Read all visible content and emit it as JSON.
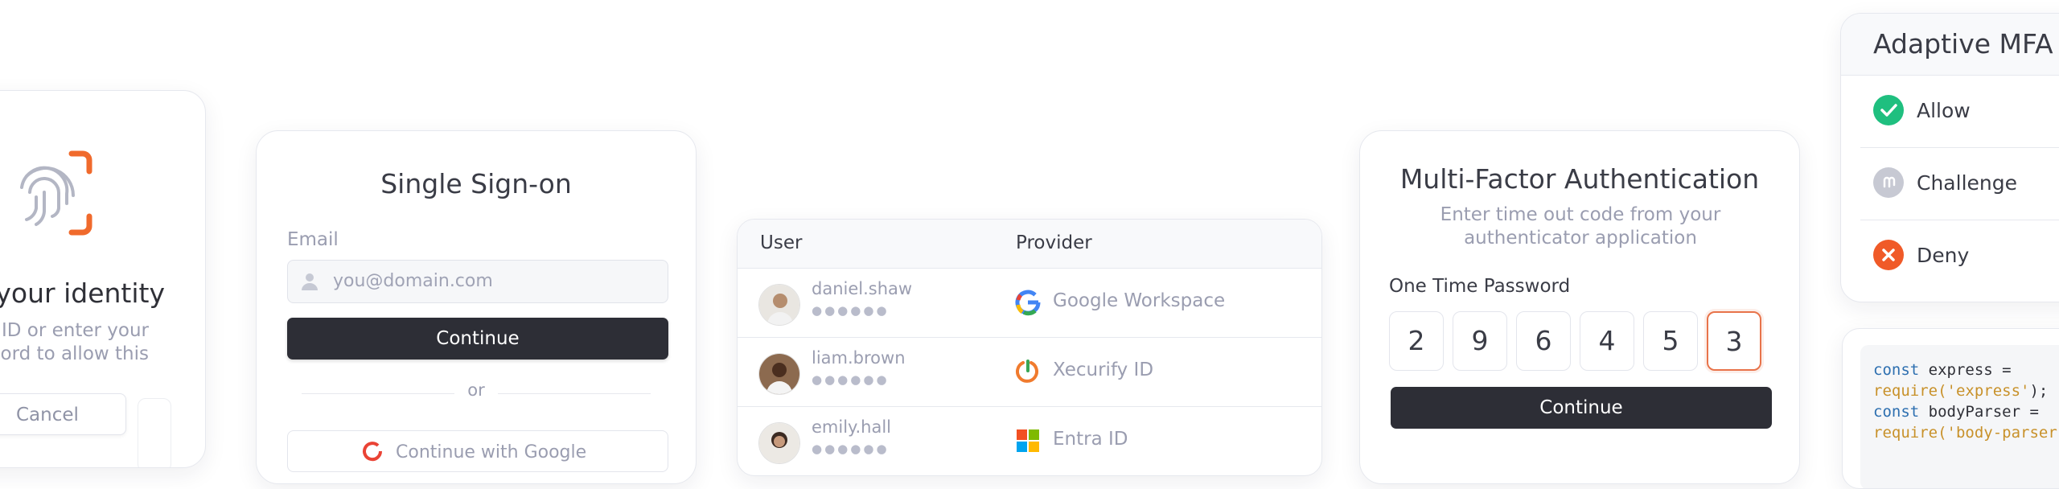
{
  "verify_card": {
    "title": "your identity",
    "subtitle_lines": [
      "ID or enter your",
      "word to allow this"
    ],
    "cancel_label": "Cancel"
  },
  "sso_card": {
    "title": "Single Sign-on",
    "email_label": "Email",
    "email_placeholder": "you@domain.com",
    "continue_label": "Continue",
    "divider_text": "or",
    "google_label": "Continue with Google"
  },
  "users_table": {
    "columns": [
      "User",
      "Provider"
    ],
    "rows": [
      {
        "user": "daniel.shaw",
        "masked": "●●●●●●",
        "provider": "Google Workspace",
        "provider_icon": "google-icon"
      },
      {
        "user": "liam.brown",
        "masked": "●●●●●●",
        "provider": "Xecurify ID",
        "provider_icon": "xecurify-icon"
      },
      {
        "user": "emily.hall",
        "masked": "●●●●●●",
        "provider": "Entra ID",
        "provider_icon": "microsoft-icon"
      }
    ]
  },
  "mfa_card": {
    "title": "Multi-Factor Authentication",
    "subtitle_lines": [
      "Enter time out code from your",
      "authenticator application"
    ],
    "otp_label": "One Time Password",
    "otp_digits": [
      "2",
      "9",
      "6",
      "4",
      "5",
      "3"
    ],
    "continue_label": "Continue"
  },
  "adaptive_card": {
    "title": "Adaptive MFA",
    "items": [
      {
        "label": "Allow",
        "color": "#1fbf7f",
        "icon": "check-icon"
      },
      {
        "label": "Challenge",
        "color": "#c7c9d3",
        "icon": "challenge-icon"
      },
      {
        "label": "Deny",
        "color": "#f05a28",
        "icon": "x-icon"
      }
    ]
  },
  "code_card": {
    "lines": [
      [
        {
          "t": "const",
          "c": "kw"
        },
        {
          "t": " express =",
          "c": "plain"
        }
      ],
      [
        {
          "t": "require(",
          "c": "str"
        },
        {
          "t": "'express'",
          "c": "str"
        },
        {
          "t": ");",
          "c": "plain"
        }
      ],
      [
        {
          "t": "const",
          "c": "kw"
        },
        {
          "t": " bodyParser =",
          "c": "plain"
        }
      ],
      [
        {
          "t": "require(",
          "c": "str"
        },
        {
          "t": "'body-parser'",
          "c": "str"
        }
      ]
    ]
  },
  "colors": {
    "accent": "#f06a2c",
    "button_dark": "#2d2e36",
    "muted_text": "#9a9db0"
  }
}
